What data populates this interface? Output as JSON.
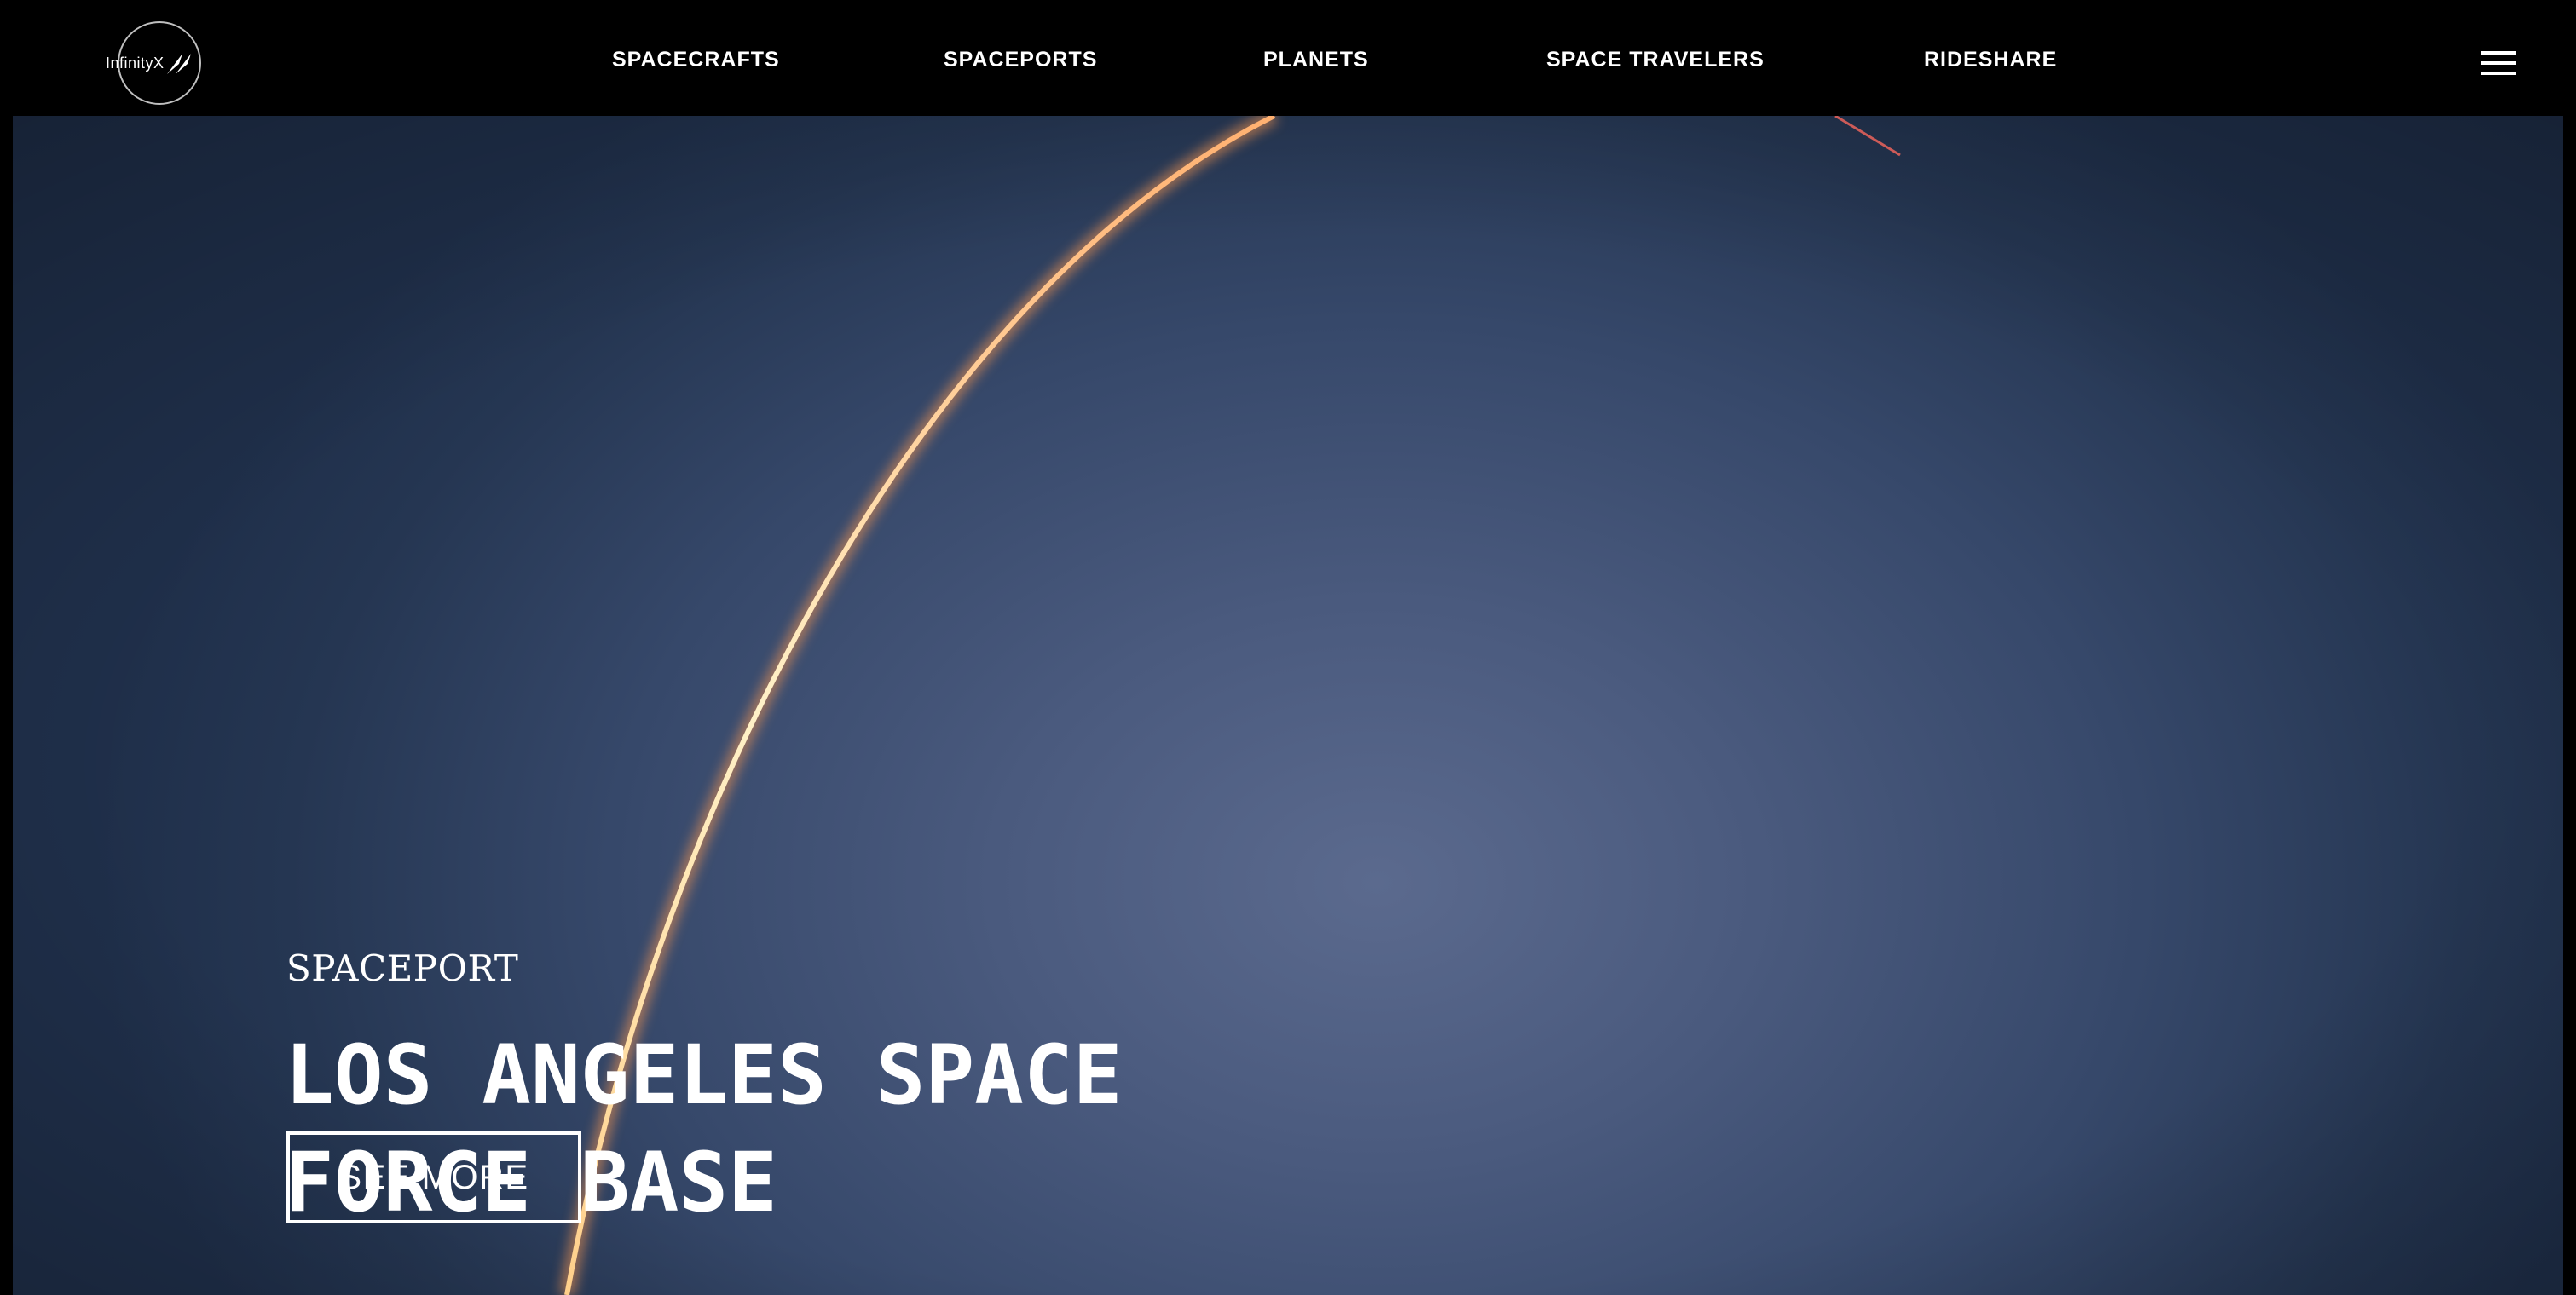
{
  "brand": {
    "logo_text": "InfinityX"
  },
  "nav": {
    "items": [
      {
        "label": "SPACECRAFTS"
      },
      {
        "label": "SPACEPORTS"
      },
      {
        "label": "PLANETS"
      },
      {
        "label": "SPACE TRAVELERS"
      },
      {
        "label": "RIDESHARE"
      }
    ],
    "menu_icon": "hamburger-menu-icon"
  },
  "hero": {
    "eyebrow": "SPACEPORT",
    "title_line1": "LOS ANGELES SPACE",
    "title_line2": "FORCE BASE",
    "cta_label": "SEE MORE",
    "background": "night-sky-rocket-launch-trail"
  },
  "colors": {
    "header_bg": "#000000",
    "text": "#ffffff",
    "sky": "#3d4d70",
    "trail": "#ffd49a"
  }
}
